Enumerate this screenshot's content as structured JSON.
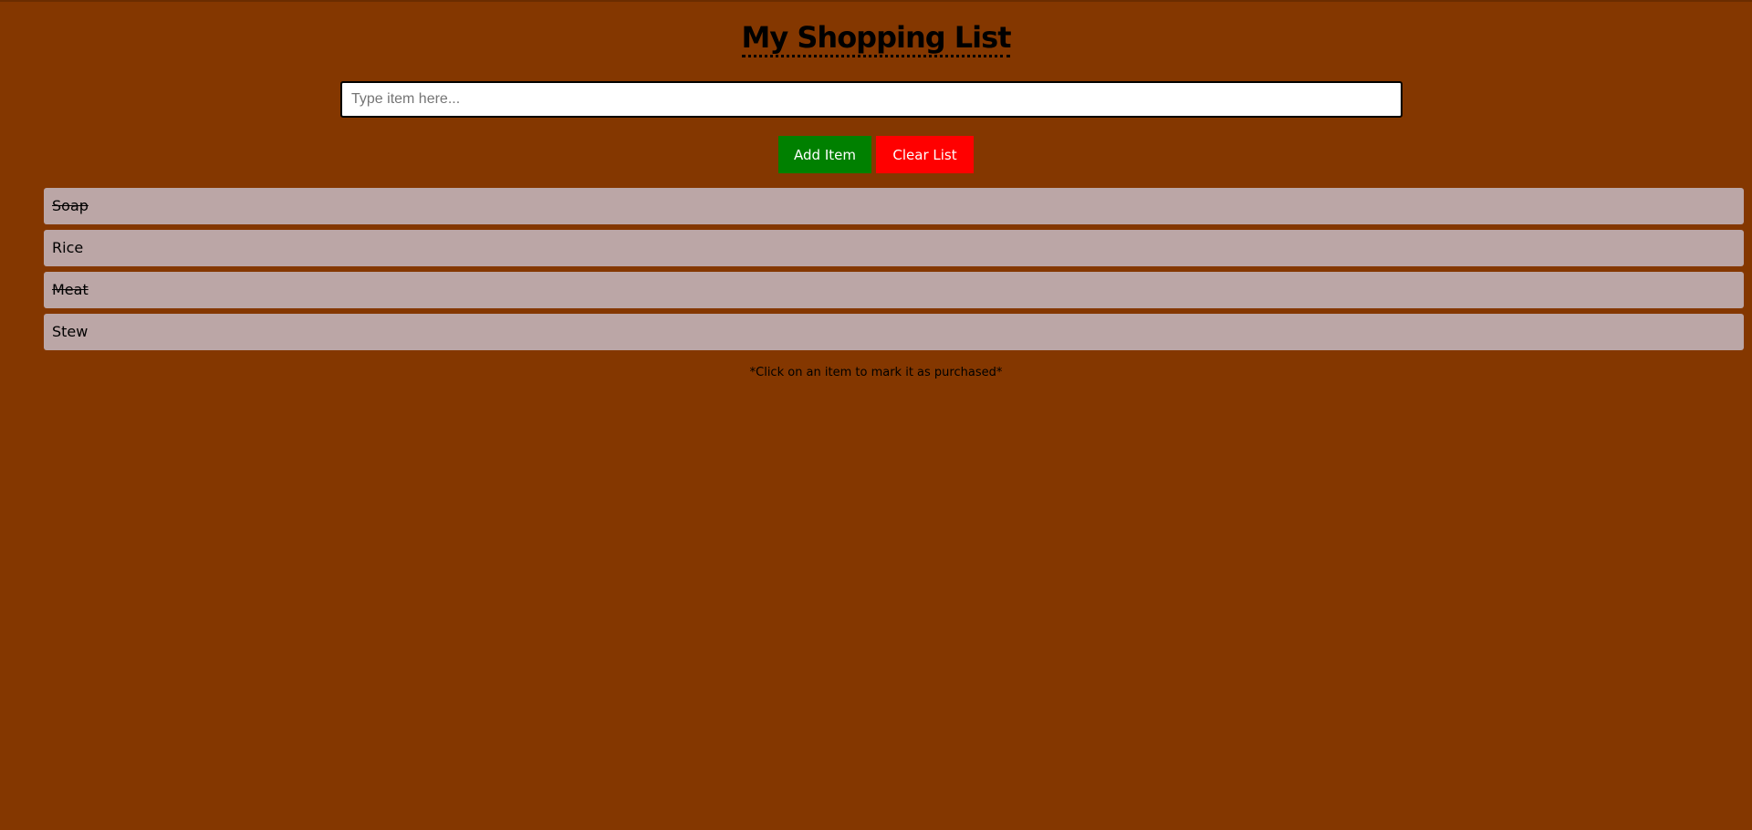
{
  "header": {
    "title": "My Shopping List"
  },
  "form": {
    "input_value": "",
    "input_placeholder": "Type item here...",
    "add_label": "Add Item",
    "clear_label": "Clear List"
  },
  "list": {
    "items": [
      {
        "label": "Soap",
        "purchased": true
      },
      {
        "label": "Rice",
        "purchased": false
      },
      {
        "label": "Meat",
        "purchased": true
      },
      {
        "label": "Stew",
        "purchased": false
      }
    ]
  },
  "footer": {
    "hint": "*Click on an item to mark it as purchased*"
  },
  "colors": {
    "background": "#843700",
    "add_button": "#008000",
    "clear_button": "#ff0000",
    "item_background": "#bba6a6"
  }
}
